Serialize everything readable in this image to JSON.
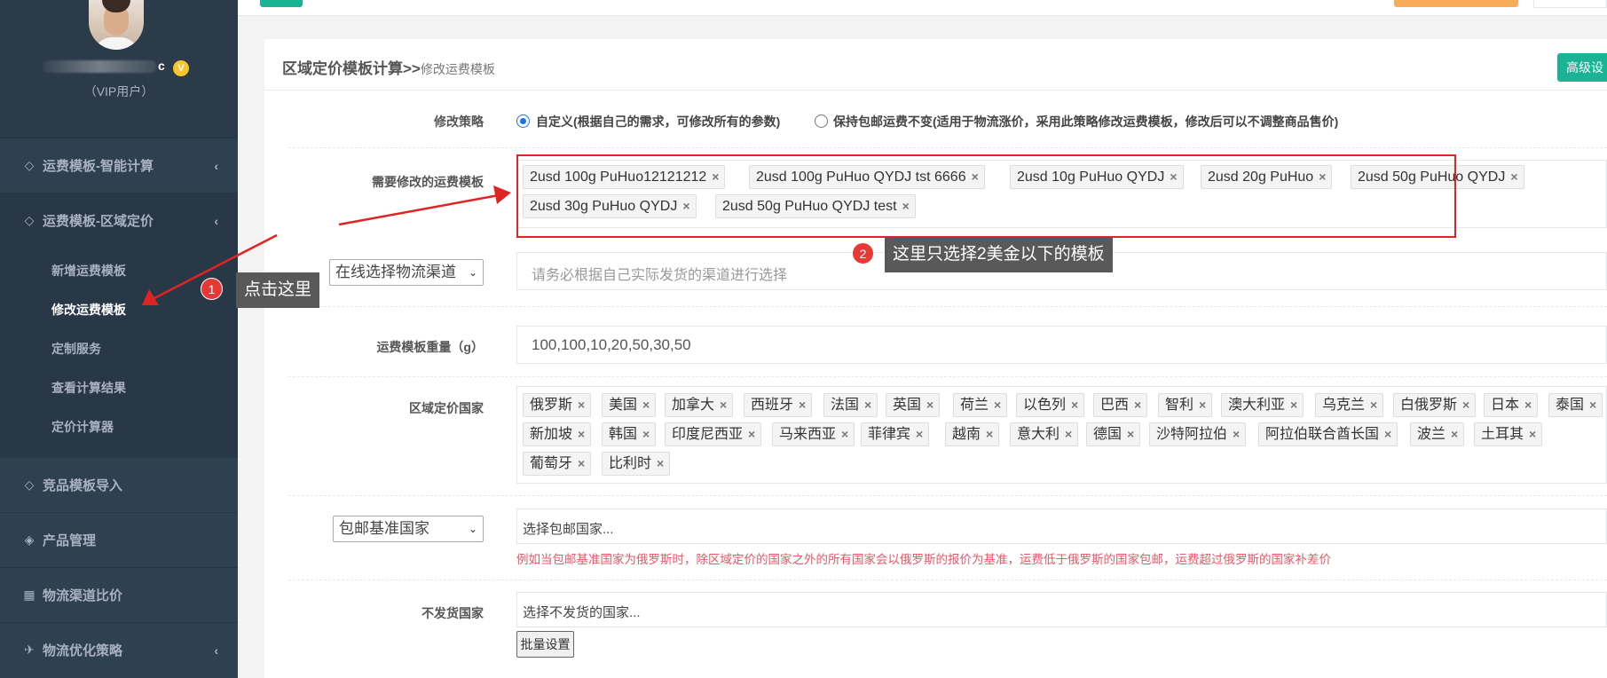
{
  "sidebar": {
    "user": {
      "name_tail": "c",
      "vip_badge": "V",
      "role": "（VIP用户）"
    },
    "nav": [
      {
        "label": "运费模板-智能计算",
        "icon": "diamond-icon",
        "chevron": "‹"
      },
      {
        "label": "运费模板-区域定价",
        "icon": "diamond-icon",
        "chevron": "‹"
      },
      {
        "label": "竞品模板导入",
        "icon": "diamond-icon"
      },
      {
        "label": "产品管理",
        "icon": "cube-icon"
      },
      {
        "label": "物流渠道比价",
        "icon": "calculator-icon"
      },
      {
        "label": "物流优化策略",
        "icon": "plane-icon",
        "chevron": "‹"
      }
    ],
    "sub_items": [
      "新增运费模板",
      "修改运费模板",
      "定制服务",
      "查看计算结果",
      "定价计算器"
    ]
  },
  "header": {
    "title": "区域定价模板计算>>",
    "subtitle": "修改运费模板",
    "advanced_button": "高级设"
  },
  "form": {
    "strategy": {
      "label": "修改策略",
      "options": [
        {
          "text": "自定义(根据自己的需求，可修改所有的参数)",
          "checked": true
        },
        {
          "text": "保持包邮运费不变(适用于物流涨价，采用此策略修改运费模板，修改后可以不调整商品售价)",
          "checked": false
        }
      ]
    },
    "templates": {
      "label": "需要修改的运费模板",
      "tags": [
        "2usd 100g PuHuo12121212",
        "2usd 100g PuHuo QYDJ tst 6666",
        "2usd 10g PuHuo QYDJ",
        "2usd 20g PuHuo",
        "2usd 50g PuHuo QYDJ",
        "2usd 30g PuHuo QYDJ",
        "2usd 50g PuHuo QYDJ test"
      ]
    },
    "channel": {
      "select_value": "在线选择物流渠道",
      "placeholder": "请务必根据自己实际发货的渠道进行选择"
    },
    "weight": {
      "label": "运费模板重量（g）",
      "value": "100,100,10,20,50,30,50"
    },
    "countries": {
      "label": "区域定价国家",
      "tags": [
        "俄罗斯",
        "美国",
        "加拿大",
        "西班牙",
        "法国",
        "英国",
        "荷兰",
        "以色列",
        "巴西",
        "智利",
        "澳大利亚",
        "乌克兰",
        "白俄罗斯",
        "日本",
        "泰国",
        "新加坡",
        "韩国",
        "印度尼西亚",
        "马来西亚",
        "菲律宾",
        "越南",
        "意大利",
        "德国",
        "沙特阿拉伯",
        "阿拉伯联合酋长国",
        "波兰",
        "土耳其",
        "葡萄牙",
        "比利时"
      ]
    },
    "free_shipping": {
      "select_value": "包邮基准国家",
      "placeholder": "选择包邮国家...",
      "hint": "例如当包邮基准国家为俄罗斯时，除区域定价的国家之外的所有国家会以俄罗斯的报价为基准，运费低于俄罗斯的国家包邮，运费超过俄罗斯的国家补差价"
    },
    "no_ship": {
      "label": "不发货国家",
      "placeholder": "选择不发货的国家...",
      "batch_button": "批量设置"
    },
    "remove_glyph": "×"
  },
  "annotations": {
    "step1": {
      "num": "1",
      "text": "点击这里"
    },
    "step2": {
      "num": "2",
      "text": "这里只选择2美金以下的模板"
    },
    "color": "#e02424"
  },
  "colors": {
    "sidebar": "#2f4050",
    "accent": "#1ab394",
    "hint": "#ed5565",
    "orange": "#f8ac59"
  }
}
